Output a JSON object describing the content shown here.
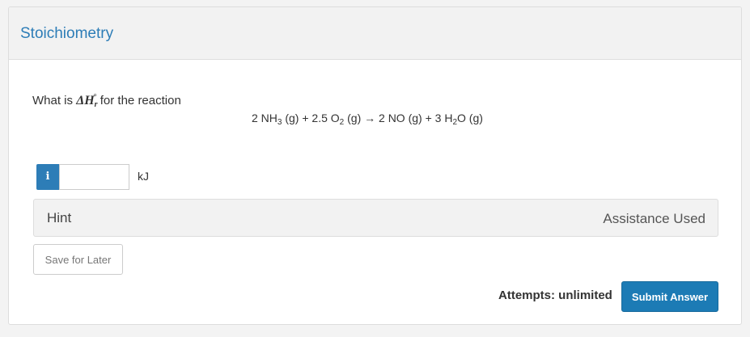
{
  "header": {
    "title": "Stoichiometry"
  },
  "question": {
    "prefix": "What is ",
    "symbol_delta": "ΔH",
    "symbol_sub": "r",
    "symbol_sup": "°",
    "suffix": " for the reaction"
  },
  "equation": {
    "t1": "2 NH",
    "s1": "3",
    "t2": " (g) + 2.5 O",
    "s2": "2",
    "t3": " (g) → 2 NO (g) + 3 H",
    "s3": "2",
    "t4": "O (g)"
  },
  "answer": {
    "badge": "i",
    "value": "",
    "unit": "kJ"
  },
  "hint": {
    "label": "Hint",
    "status": "Assistance Used"
  },
  "actions": {
    "save_label": "Save for Later",
    "attempts": "Attempts: unlimited",
    "submit_label": "Submit Answer"
  },
  "colors": {
    "accent": "#2d7db7",
    "submit": "#1c7bb5",
    "panel": "#f2f2f2"
  },
  "icons": {
    "info": "info-icon"
  }
}
